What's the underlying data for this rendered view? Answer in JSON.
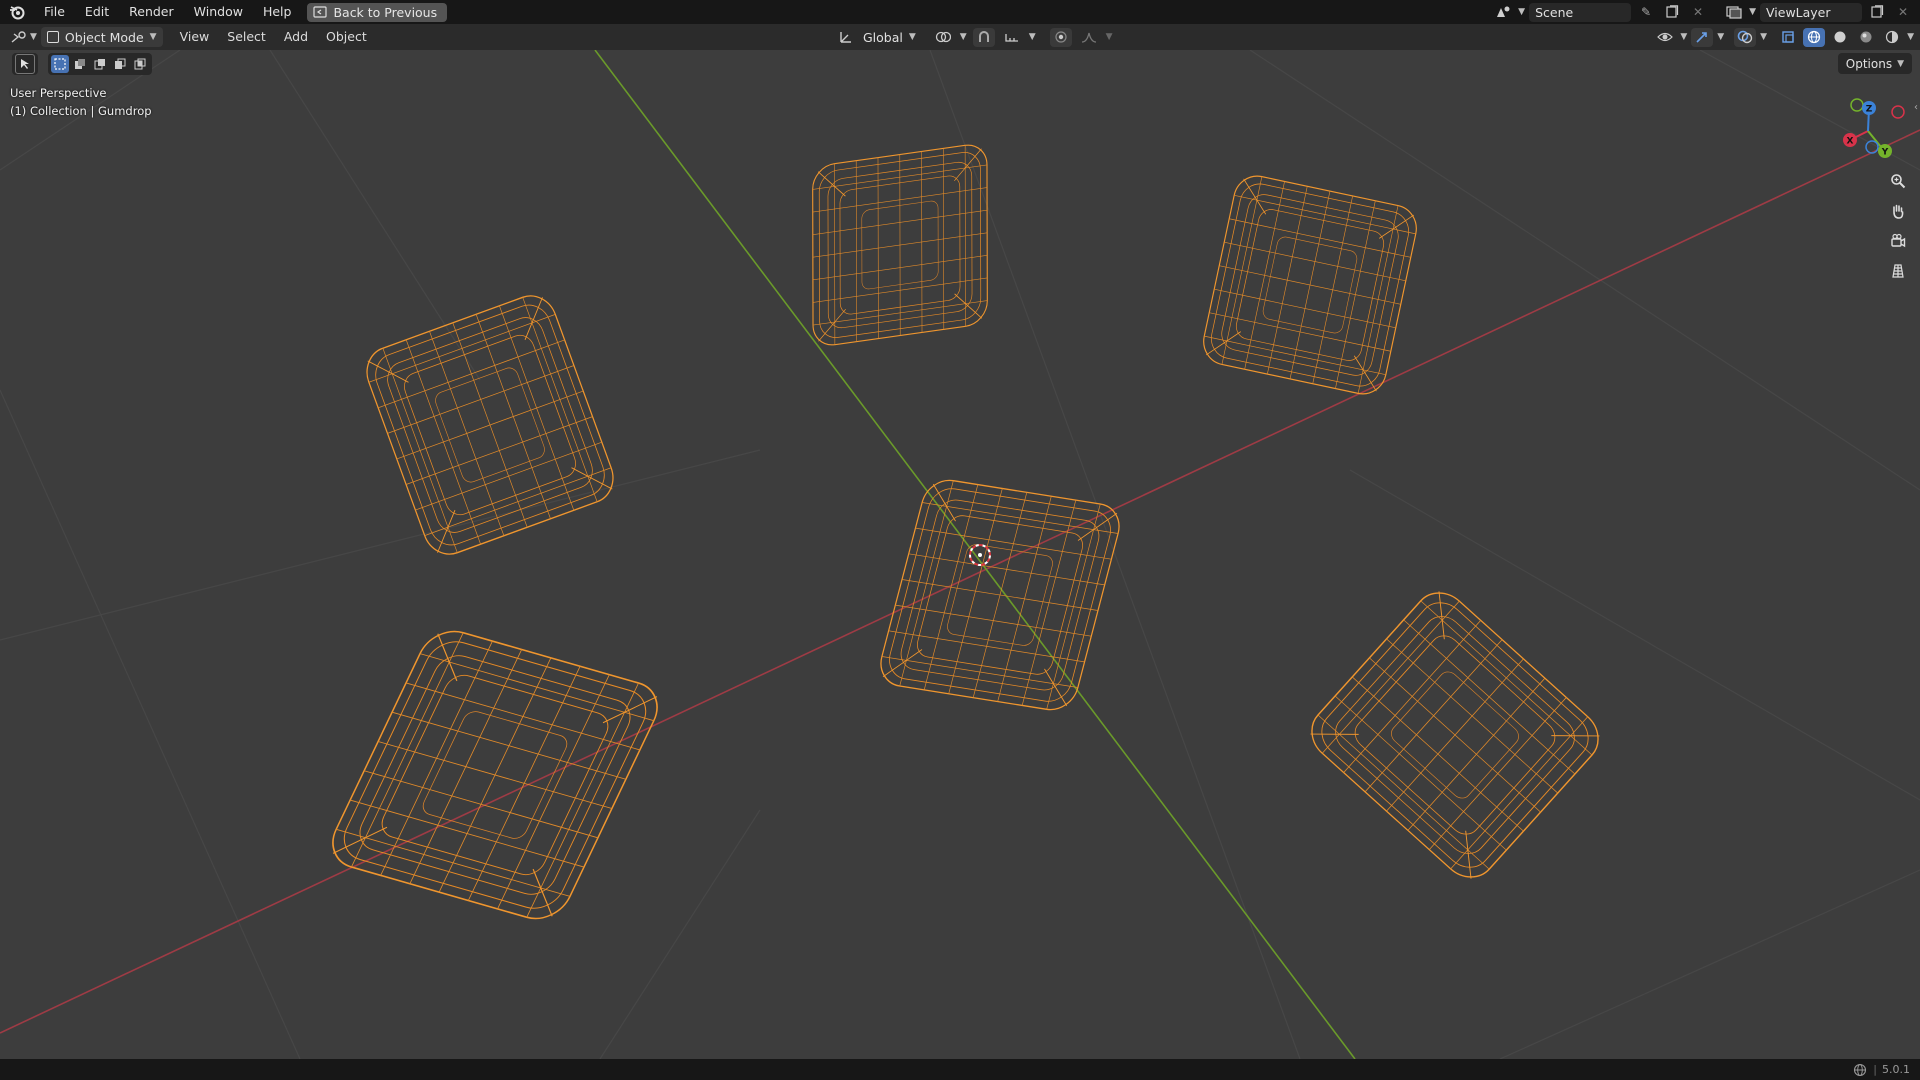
{
  "topbar": {
    "menus": [
      "File",
      "Edit",
      "Render",
      "Window",
      "Help"
    ],
    "back_label": "Back to Previous",
    "scene_name": "Scene",
    "view_layer": "ViewLayer"
  },
  "header": {
    "mode": "Object Mode",
    "menus": [
      "View",
      "Select",
      "Add",
      "Object"
    ],
    "transform_orientation": "Global",
    "options_label": "Options"
  },
  "viewport": {
    "perspective_label": "User Perspective",
    "collection_label": "(1) Collection | Gumdrop",
    "wire_color": "#f0962e",
    "x_axis_color": "#9e3b45",
    "y_axis_color": "#6a9a2a"
  },
  "gizmo": {
    "x": "X",
    "y": "Y",
    "z": "Z"
  },
  "status": {
    "version": "5.0.1"
  },
  "colors": {
    "active_tool": "#4772b3",
    "background": "#3d3d3d"
  }
}
